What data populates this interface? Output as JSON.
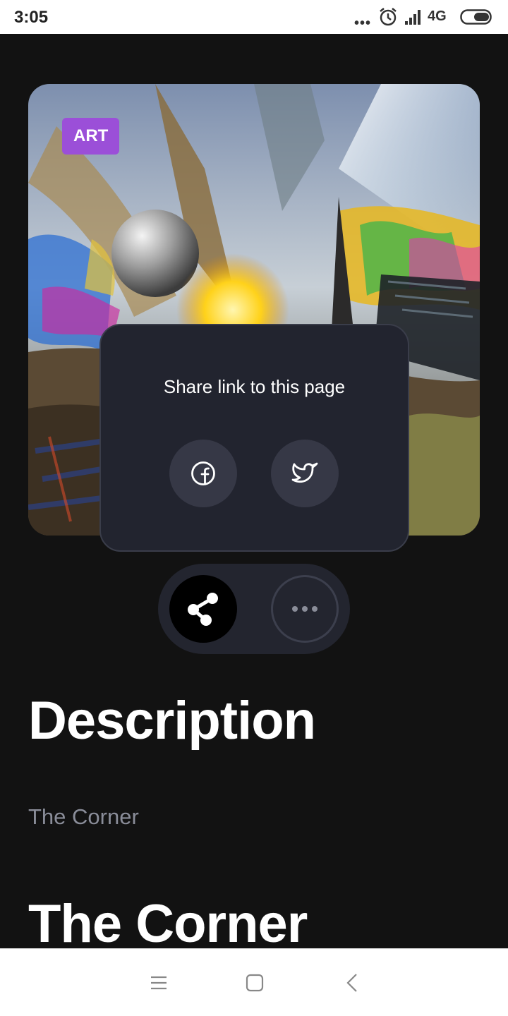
{
  "status_bar": {
    "time": "3:05",
    "network": "4G",
    "dots": "•••"
  },
  "hero": {
    "badge": "ART"
  },
  "share_popup": {
    "title": "Share link to this page",
    "buttons": [
      {
        "icon": "facebook-icon"
      },
      {
        "icon": "twitter-icon"
      }
    ]
  },
  "actions": {
    "share_icon": "share-icon",
    "more_icon": "more-icon"
  },
  "content": {
    "description_heading": "Description",
    "description_text": "The Corner",
    "title_heading": "The Corner"
  },
  "nav_bar": {
    "icons": [
      "menu-icon",
      "home-icon",
      "back-icon"
    ]
  },
  "colors": {
    "badge": "#9b4fd8",
    "background": "#121212",
    "popup": "#22242f"
  }
}
